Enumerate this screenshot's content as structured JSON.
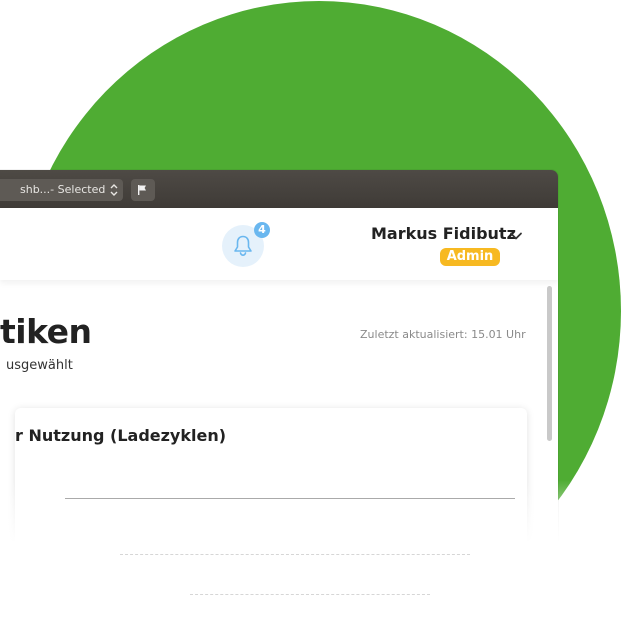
{
  "toolbar": {
    "popup_label": "shb...- Selected",
    "popup_arrows_icon": "up-down-arrows-icon",
    "flag_icon": "flag-icon"
  },
  "header": {
    "notification_count": "4",
    "user_name": "Markus Fidibutz",
    "role": "Admin",
    "bell_icon": "bell-icon",
    "chevron_icon": "chevron-down-icon"
  },
  "main": {
    "title": "tiken",
    "subtitle": "usgewählt",
    "last_updated": "Zuletzt aktualisiert: 15.01 Uhr",
    "card": {
      "title": "r Nutzung (Ladezyklen)"
    }
  },
  "colors": {
    "accent_green": "#4fac33",
    "badge_blue": "#6ab7ef",
    "admin_badge": "#f7b921"
  }
}
